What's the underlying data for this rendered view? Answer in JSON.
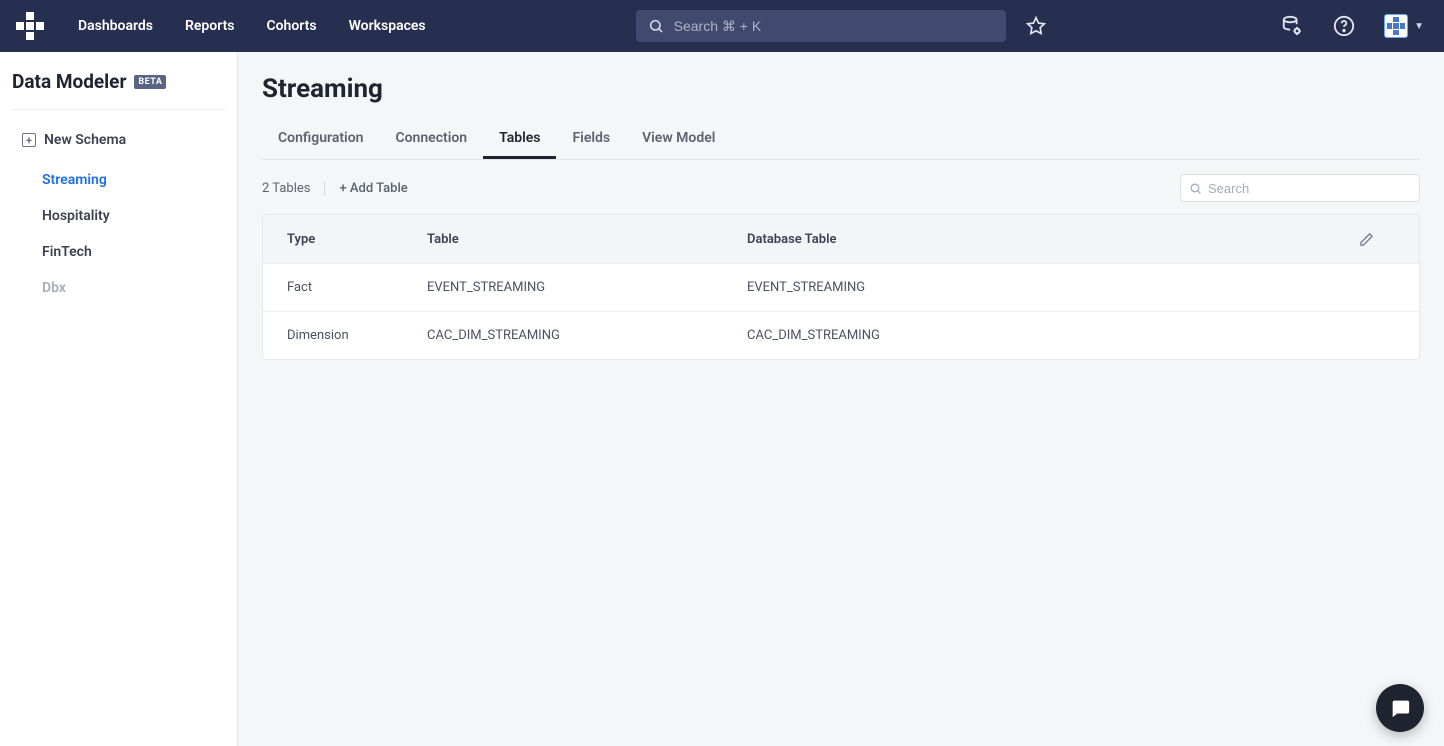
{
  "nav": {
    "links": [
      "Dashboards",
      "Reports",
      "Cohorts",
      "Workspaces"
    ],
    "search_placeholder": "Search ⌘ + K"
  },
  "sidebar": {
    "title": "Data Modeler",
    "badge": "BETA",
    "new_schema_label": "New Schema",
    "items": [
      {
        "label": "Streaming",
        "active": true
      },
      {
        "label": "Hospitality",
        "active": false
      },
      {
        "label": "FinTech",
        "active": false
      },
      {
        "label": "Dbx",
        "active": false,
        "muted": true
      }
    ]
  },
  "page": {
    "title": "Streaming",
    "tabs": [
      "Configuration",
      "Connection",
      "Tables",
      "Fields",
      "View Model"
    ],
    "active_tab": "Tables",
    "table_count_label": "2 Tables",
    "add_table_label": "+ Add Table",
    "table_search_placeholder": "Search",
    "columns": [
      "Type",
      "Table",
      "Database Table"
    ],
    "rows": [
      {
        "type": "Fact",
        "table": "EVENT_STREAMING",
        "db_table": "EVENT_STREAMING"
      },
      {
        "type": "Dimension",
        "table": "CAC_DIM_STREAMING",
        "db_table": "CAC_DIM_STREAMING"
      }
    ]
  }
}
